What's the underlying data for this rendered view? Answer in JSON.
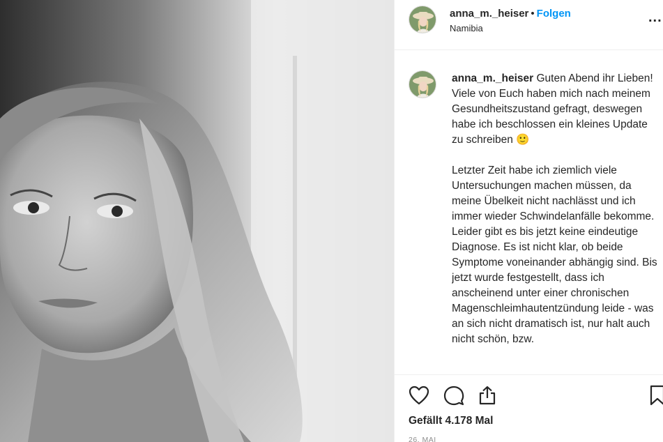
{
  "post": {
    "username": "anna_m._heiser",
    "separator": "•",
    "follow_label": "Folgen",
    "location": "Namibia",
    "more_label": "..."
  },
  "caption": {
    "username": "anna_m._heiser",
    "paragraph1": "Guten Abend ihr Lieben! Viele von Euch haben mich nach meinem Gesundheitszustand gefragt, deswegen habe ich beschlossen ein kleines Update zu schreiben 🙂",
    "paragraph2": "Letzter Zeit habe ich ziemlich viele Untersuchungen machen müssen, da meine Übelkeit nicht nachlässt und ich immer wieder Schwindelanfälle bekomme. Leider gibt es bis jetzt keine eindeutige Diagnose. Es ist nicht klar, ob beide Symptome voneinander abhängig sind. Bis jetzt wurde festgestellt, dass ich anscheinend unter einer chronischen Magenschleimhautentzündung leide - was an sich nicht dramatisch ist, nur halt auch nicht schön, bzw."
  },
  "stats": {
    "likes": "Gefällt 4.178 Mal",
    "date": "26. MAI"
  },
  "icons": {
    "heart": "heart-icon",
    "comment": "comment-icon",
    "share": "share-icon",
    "bookmark": "bookmark-icon"
  }
}
